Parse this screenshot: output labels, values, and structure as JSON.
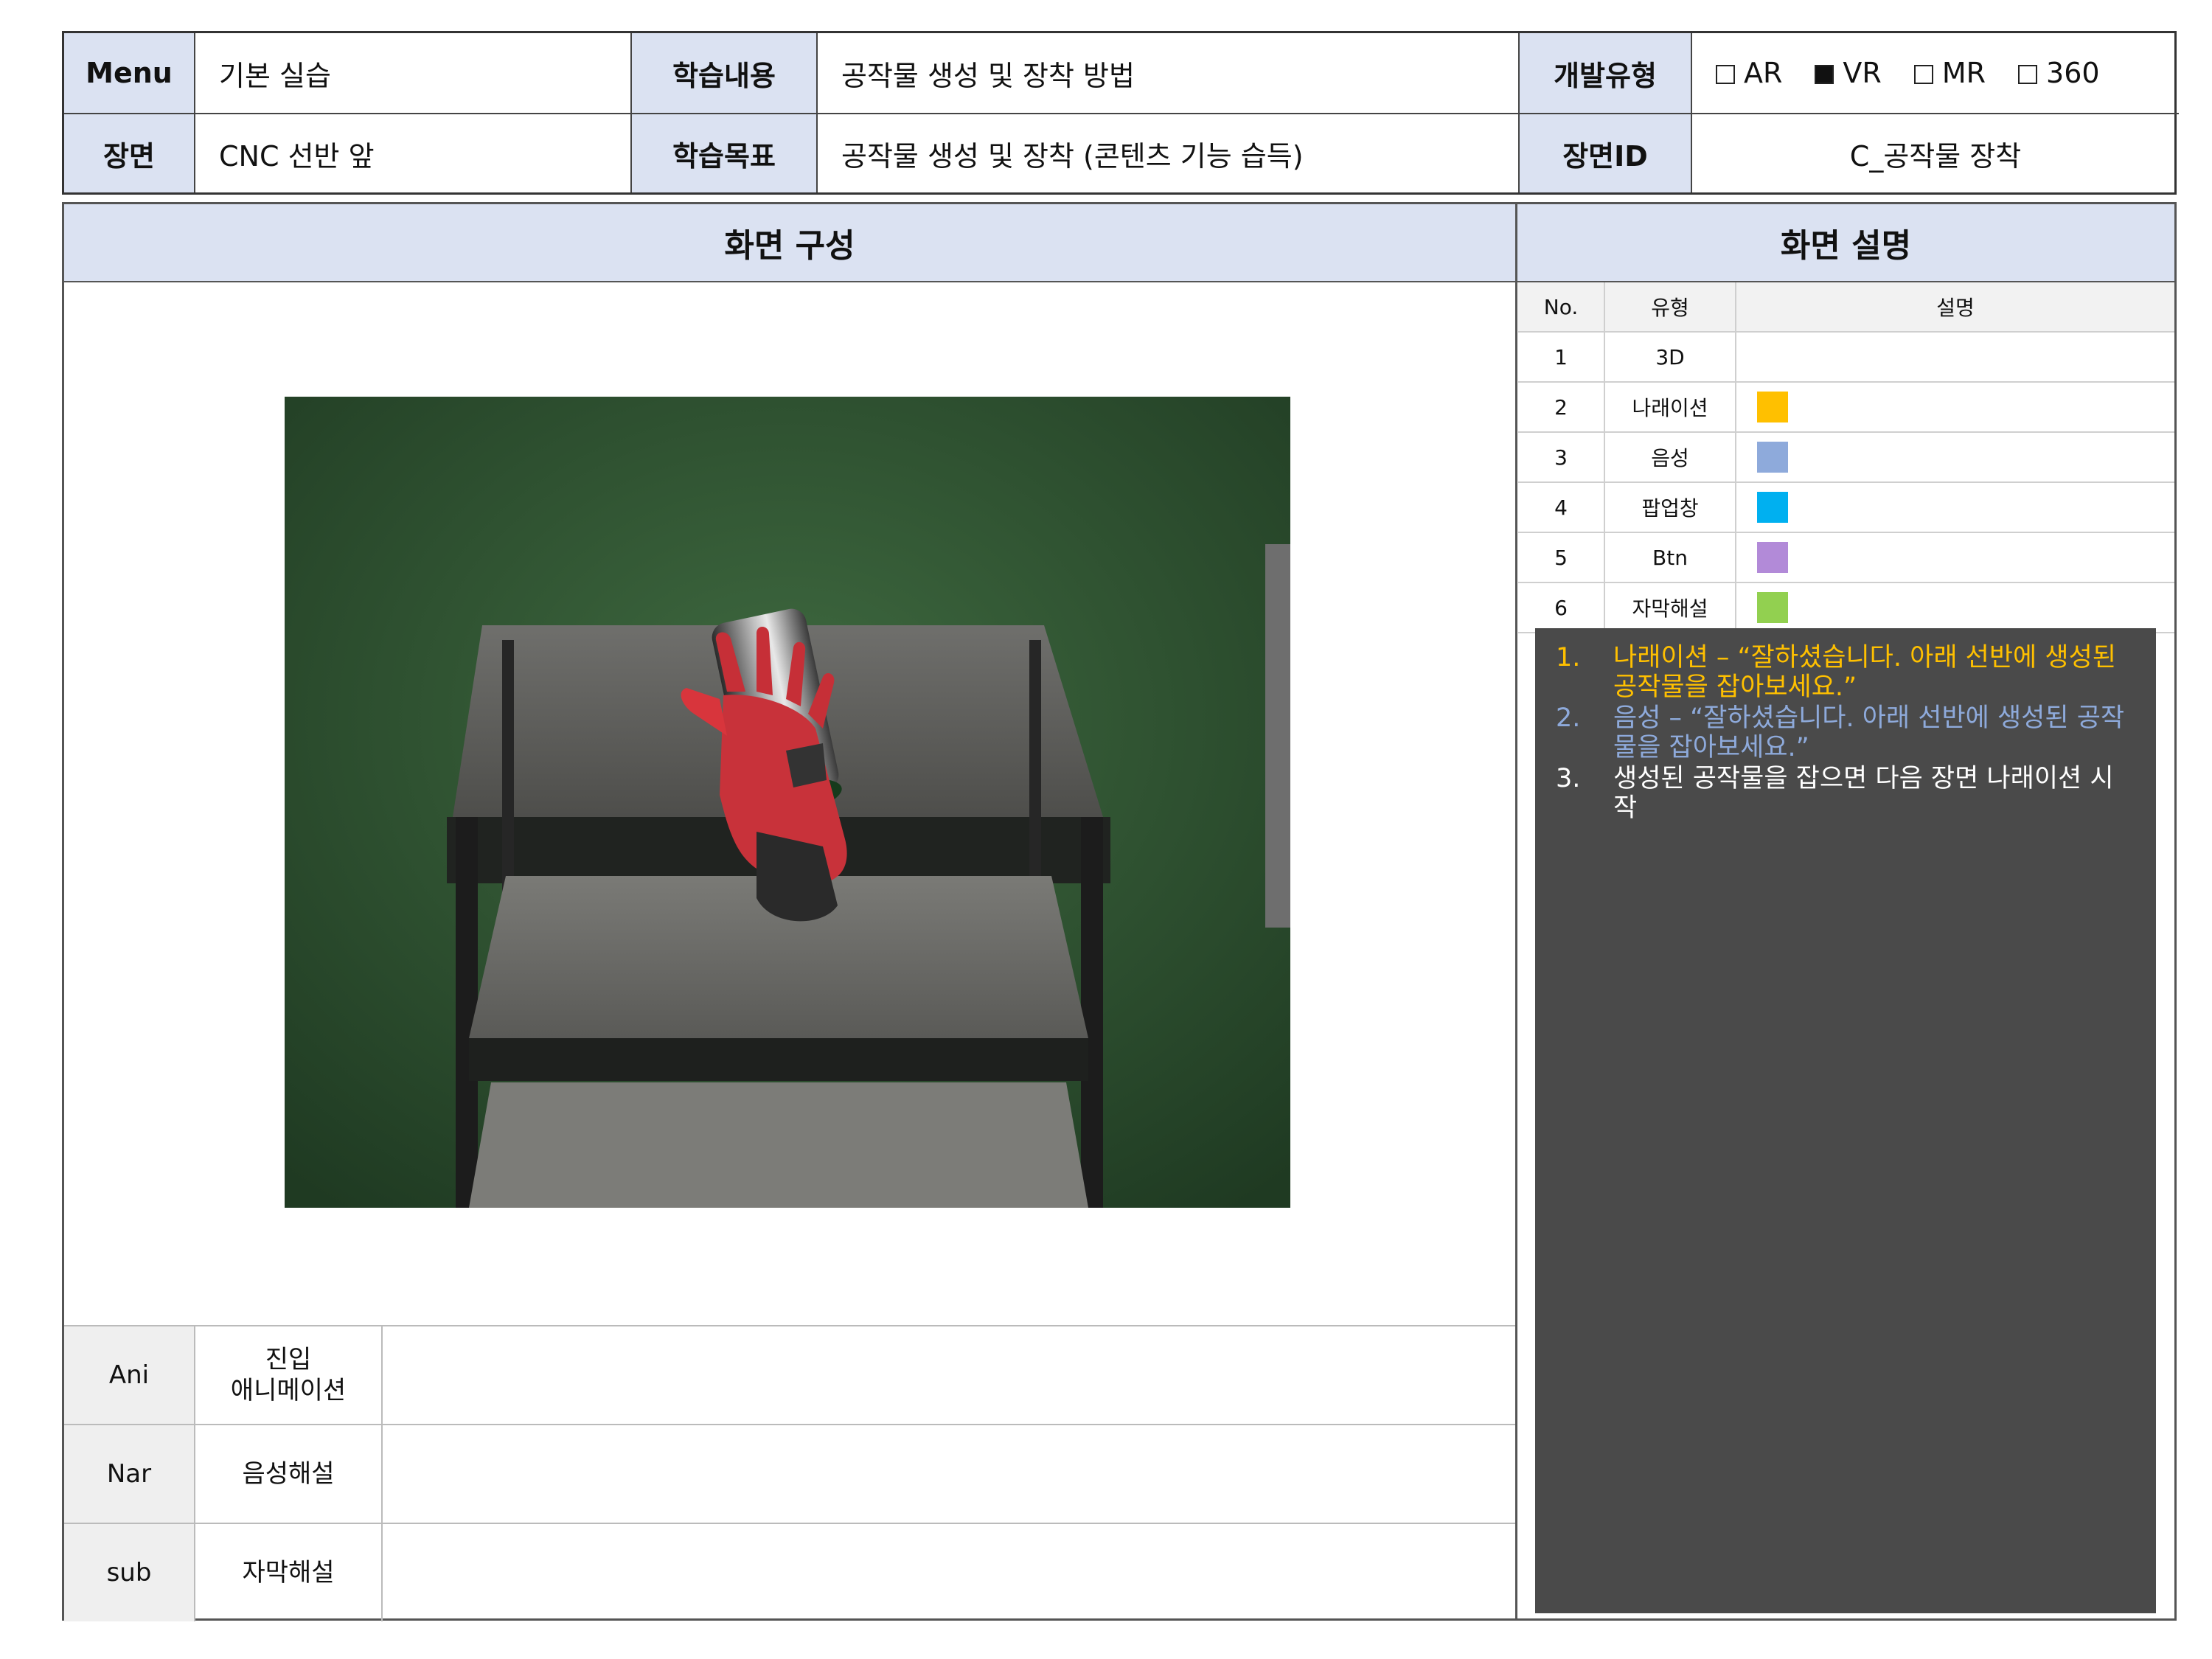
{
  "header": {
    "menu_label": "Menu",
    "menu_value": "기본 실습",
    "content_label": "학습내용",
    "content_value": "공작물 생성 및 장착 방법",
    "devtype_label": "개발유형",
    "scene_label": "장면",
    "scene_value": "CNC 선반 앞",
    "goal_label": "학습목표",
    "goal_value": "공작물 생성 및 장착 (콘텐츠 기능 습득)",
    "sceneid_label": "장면ID",
    "sceneid_value": "C_공작물 장착",
    "dev_options": [
      {
        "label": "AR",
        "checked": false
      },
      {
        "label": "VR",
        "checked": true
      },
      {
        "label": "MR",
        "checked": false
      },
      {
        "label": "360",
        "checked": false
      }
    ]
  },
  "left_title": "화면 구성",
  "right_title": "화면 설명",
  "bottom_rows": [
    {
      "code": "Ani",
      "type": "진입\n애니메이션",
      "content": ""
    },
    {
      "code": "Nar",
      "type": "음성해설",
      "content": ""
    },
    {
      "code": "sub",
      "type": "자막해설",
      "content": ""
    }
  ],
  "legend": {
    "headers": [
      "No.",
      "유형",
      "설명"
    ],
    "rows": [
      {
        "no": "1",
        "type": "3D",
        "color": ""
      },
      {
        "no": "2",
        "type": "나래이션",
        "color": "#ffc000"
      },
      {
        "no": "3",
        "type": "음성",
        "color": "#8eaadb"
      },
      {
        "no": "4",
        "type": "팝업창",
        "color": "#00b0f0"
      },
      {
        "no": "5",
        "type": "Btn",
        "color": "#b28ad8"
      },
      {
        "no": "6",
        "type": "자막해설",
        "color": "#92d050"
      }
    ]
  },
  "notes": [
    {
      "num": "1.",
      "text": "나래이션 – “잘하셨습니다. 아래 선반에 생성된 공작물을 잡아보세요.”",
      "color": "#ffc000"
    },
    {
      "num": "2.",
      "text": "음성 – “잘하셨습니다. 아래 선반에 생성된 공작물을 잡아보세요.”",
      "color": "#8eaadb"
    },
    {
      "num": "3.",
      "text": "생성된 공작물을 잡으면 다음 장면 나래이션 시작",
      "color": "#ffffff"
    }
  ]
}
